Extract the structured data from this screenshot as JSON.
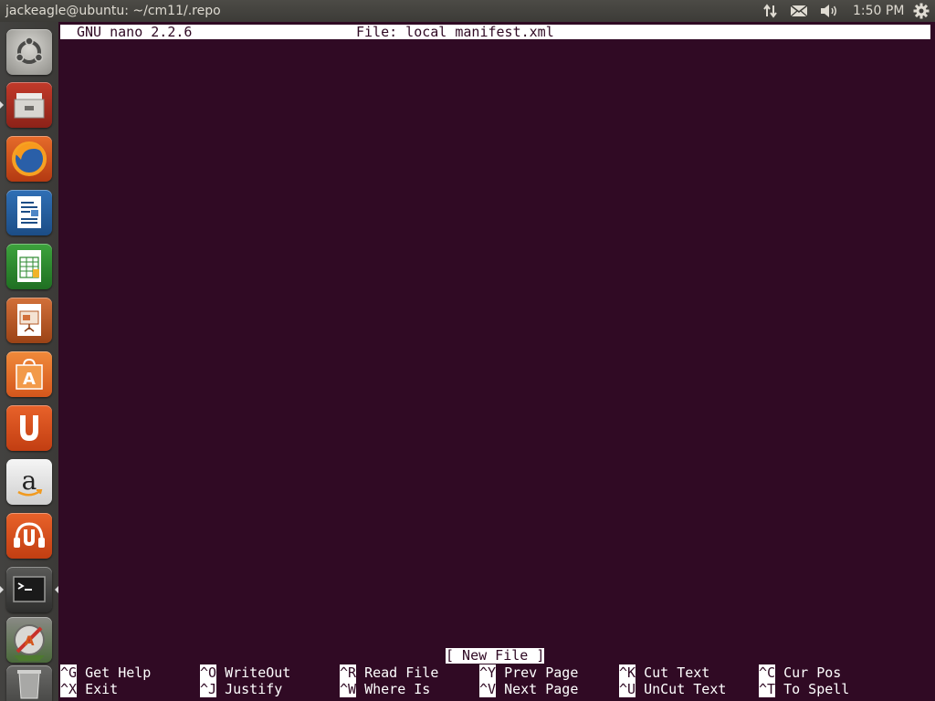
{
  "panel": {
    "window_title": "jackeagle@ubuntu: ~/cm11/.repo",
    "clock": "1:50 PM",
    "tray_icons": [
      "network-icon",
      "mail-icon",
      "volume-icon",
      "gear-icon"
    ]
  },
  "launcher": {
    "items": [
      {
        "name": "ubuntu-dash",
        "icon": "ubuntu-logo-icon"
      },
      {
        "name": "files",
        "icon": "file-cabinet-icon"
      },
      {
        "name": "firefox",
        "icon": "firefox-icon"
      },
      {
        "name": "libreoffice-writer",
        "icon": "writer-icon"
      },
      {
        "name": "libreoffice-calc",
        "icon": "calc-icon"
      },
      {
        "name": "libreoffice-impress",
        "icon": "impress-icon"
      },
      {
        "name": "ubuntu-software-center",
        "icon": "software-center-icon"
      },
      {
        "name": "ubuntu-one",
        "icon": "ubuntu-one-icon"
      },
      {
        "name": "amazon",
        "icon": "amazon-icon"
      },
      {
        "name": "ubuntu-one-music",
        "icon": "ubuntu-one-music-icon"
      },
      {
        "name": "terminal",
        "icon": "terminal-icon"
      },
      {
        "name": "software-updater",
        "icon": "updater-icon"
      },
      {
        "name": "trash",
        "icon": "trash-icon"
      }
    ]
  },
  "nano": {
    "version": "GNU nano 2.2.6",
    "file": "File: local_manifest.xml",
    "status": "[ New File ]",
    "shortcuts": [
      {
        "key": "^G",
        "label": "Get Help"
      },
      {
        "key": "^O",
        "label": "WriteOut"
      },
      {
        "key": "^R",
        "label": "Read File"
      },
      {
        "key": "^Y",
        "label": "Prev Page"
      },
      {
        "key": "^K",
        "label": "Cut Text"
      },
      {
        "key": "^C",
        "label": "Cur Pos"
      },
      {
        "key": "^X",
        "label": "Exit"
      },
      {
        "key": "^J",
        "label": "Justify"
      },
      {
        "key": "^W",
        "label": "Where Is"
      },
      {
        "key": "^V",
        "label": "Next Page"
      },
      {
        "key": "^U",
        "label": "UnCut Text"
      },
      {
        "key": "^T",
        "label": "To Spell"
      }
    ]
  },
  "colors": {
    "terminal_bg": "#300a24",
    "panel_bg": "#3c3b37",
    "launcher_bg": "#3e3d3a",
    "highlight": "#ffffff"
  }
}
